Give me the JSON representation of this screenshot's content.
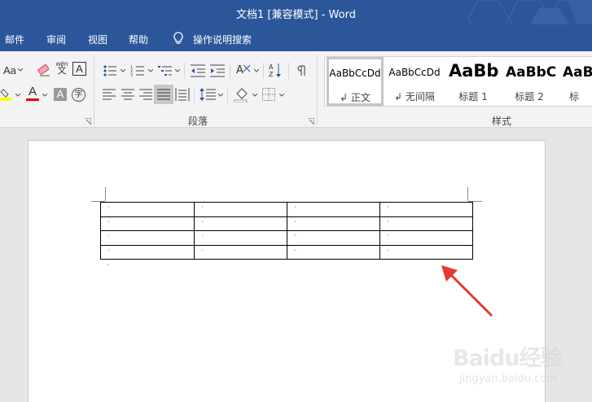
{
  "window": {
    "title": "文档1 [兼容模式]  -  Word"
  },
  "menu": {
    "tabs": [
      "邮件",
      "审阅",
      "视图",
      "帮助"
    ],
    "tell_me": "操作说明搜索"
  },
  "ribbon": {
    "font_group": {
      "change_case_label": "Aa",
      "phonetic_guide_top": "wén",
      "phonetic_guide_bottom": "文",
      "char_border_label": "A",
      "font_color_label": "A",
      "char_shading_label": "A",
      "enclose_char_label": "字"
    },
    "paragraph_group": {
      "label": "段落"
    },
    "styles_group": {
      "label": "样式",
      "items": [
        {
          "sample": "AaBbCcDd",
          "name": "正文",
          "selected": true
        },
        {
          "sample": "AaBbCcDd",
          "name": "无间隔"
        },
        {
          "sample": "AaBb",
          "name": "标题 1"
        },
        {
          "sample": "AaBbC",
          "name": "标题 2"
        },
        {
          "sample": "AaB",
          "name": "标"
        }
      ]
    }
  },
  "document": {
    "table": {
      "rows": 4,
      "cols": 4,
      "cell_mark": "ᐟ"
    },
    "paragraph_mark": "ᐟ"
  },
  "watermark": {
    "brand": "Baidu经验",
    "url": "jingyan.baidu.com"
  },
  "colors": {
    "title_bar": "#2b579a",
    "ribbon": "#f3f3f3",
    "arrow": "#e53935",
    "document_bg": "#e6e6e6"
  }
}
